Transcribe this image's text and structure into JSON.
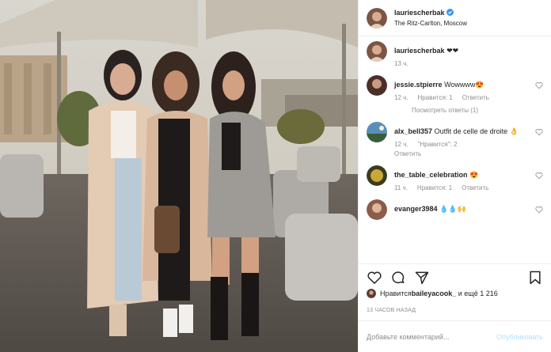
{
  "header": {
    "username": "lauriescherbak",
    "location": "The Ritz-Carlton, Moscow"
  },
  "caption": {
    "username": "lauriescherbak",
    "text": "❤❤",
    "time": "13 ч."
  },
  "comments": [
    {
      "username": "jessie.stpierre",
      "text": "Wowwww😍",
      "time": "12 ч.",
      "like_label": "Нравится: 1",
      "reply_label": "Ответить",
      "view_replies": "Посмотреть ответы (1)"
    },
    {
      "username": "alx_bell357",
      "text": "Outfit de celle de droite 👌",
      "time": "12 ч.",
      "like_label": "\"Нравится\": 2",
      "reply_label": "Ответить"
    },
    {
      "username": "the_table_celebration",
      "text": "😍",
      "time": "11 ч.",
      "like_label": "Нравится: 1",
      "reply_label": "Ответить"
    },
    {
      "username": "evanger3984",
      "text": "💧💧🙌",
      "time": "",
      "like_label": "",
      "reply_label": ""
    }
  ],
  "likes": {
    "prefix": "Нравится ",
    "user": "baileyacook_",
    "suffix": " и ещё 1 216"
  },
  "posted": "13 ЧАСОВ НАЗАД",
  "add_comment": {
    "placeholder": "Добавьте комментарий...",
    "publish": "Опубликовать"
  },
  "colors": {
    "verified": "#3897f0",
    "muted": "#8e8e8e",
    "publish_disabled": "#b2dffc"
  },
  "icons": [
    "verified-badge-icon",
    "heart-icon",
    "comment-icon",
    "share-icon",
    "bookmark-icon",
    "small-heart-icon"
  ]
}
